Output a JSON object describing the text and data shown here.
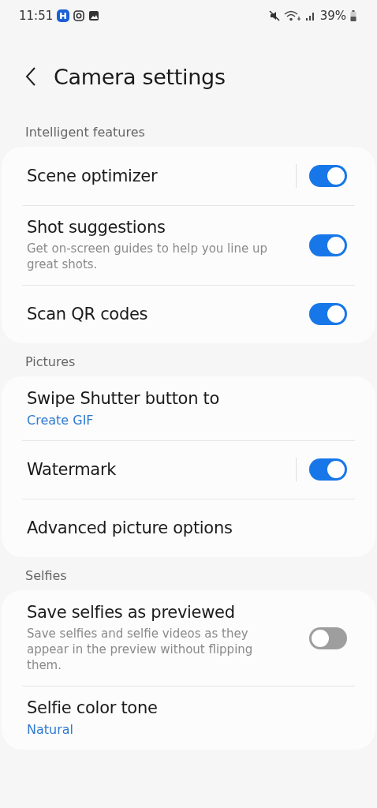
{
  "status_bar": {
    "time": "11:51",
    "battery": "39%"
  },
  "header": {
    "title": "Camera settings"
  },
  "sections": [
    {
      "label": "Intelligent features",
      "items": [
        {
          "kind": "toggle",
          "title": "Scene optimizer",
          "split": true,
          "on": true
        },
        {
          "kind": "toggle",
          "title": "Shot suggestions",
          "subtitle": "Get on-screen guides to help you line up great shots.",
          "split": false,
          "on": true
        },
        {
          "kind": "toggle",
          "title": "Scan QR codes",
          "split": false,
          "on": true
        }
      ]
    },
    {
      "label": "Pictures",
      "items": [
        {
          "kind": "link",
          "title": "Swipe Shutter button to",
          "value": "Create GIF"
        },
        {
          "kind": "toggle",
          "title": "Watermark",
          "split": true,
          "on": true
        },
        {
          "kind": "link",
          "title": "Advanced picture options"
        }
      ]
    },
    {
      "label": "Selfies",
      "items": [
        {
          "kind": "toggle",
          "title": "Save selfies as previewed",
          "subtitle": "Save selfies and selfie videos as they appear in the preview without flipping them.",
          "split": false,
          "on": false
        },
        {
          "kind": "link",
          "title": "Selfie color tone",
          "value": "Natural"
        }
      ]
    }
  ]
}
